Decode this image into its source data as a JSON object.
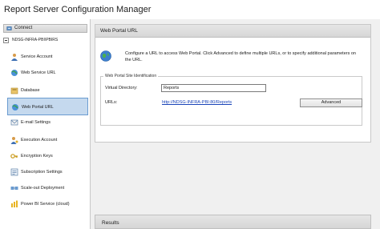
{
  "window": {
    "title": "Report Server Configuration Manager"
  },
  "sidebar": {
    "connect_label": "Connect",
    "server_label": "NDSG-INFRA-PBI\\PBIRS",
    "items": [
      {
        "label": "Service Account",
        "icon": "service-account-icon"
      },
      {
        "label": "Web Service URL",
        "icon": "web-service-url-icon"
      },
      {
        "label": "Database",
        "icon": "database-icon"
      },
      {
        "label": "Web Portal URL",
        "icon": "web-portal-url-icon",
        "selected": true
      },
      {
        "label": "E-mail Settings",
        "icon": "email-icon"
      },
      {
        "label": "Execution Account",
        "icon": "execution-account-icon"
      },
      {
        "label": "Encryption Keys",
        "icon": "key-icon"
      },
      {
        "label": "Subscription Settings",
        "icon": "subscription-icon"
      },
      {
        "label": "Scale-out Deployment",
        "icon": "scale-out-icon"
      },
      {
        "label": "Power BI Service (cloud)",
        "icon": "power-bi-icon"
      }
    ]
  },
  "main": {
    "header": "Web Portal URL",
    "description": "Configure a URL to access Web Portal. Click Advanced to define multiple URLs, or to specify additional parameters on the URL.",
    "group_label": "Web Portal Site Identification",
    "virtual_directory_label": "Virtual Directory:",
    "virtual_directory_value": "Reports",
    "urls_label": "URLs:",
    "url_value": "http://NDSG-INFRA-PBI:80/Reports",
    "advanced_button": "Advanced",
    "results_header": "Results"
  },
  "colors": {
    "selected_bg": "#c5d9ee",
    "selected_border": "#6a9bd0",
    "link": "#1a44b8"
  }
}
